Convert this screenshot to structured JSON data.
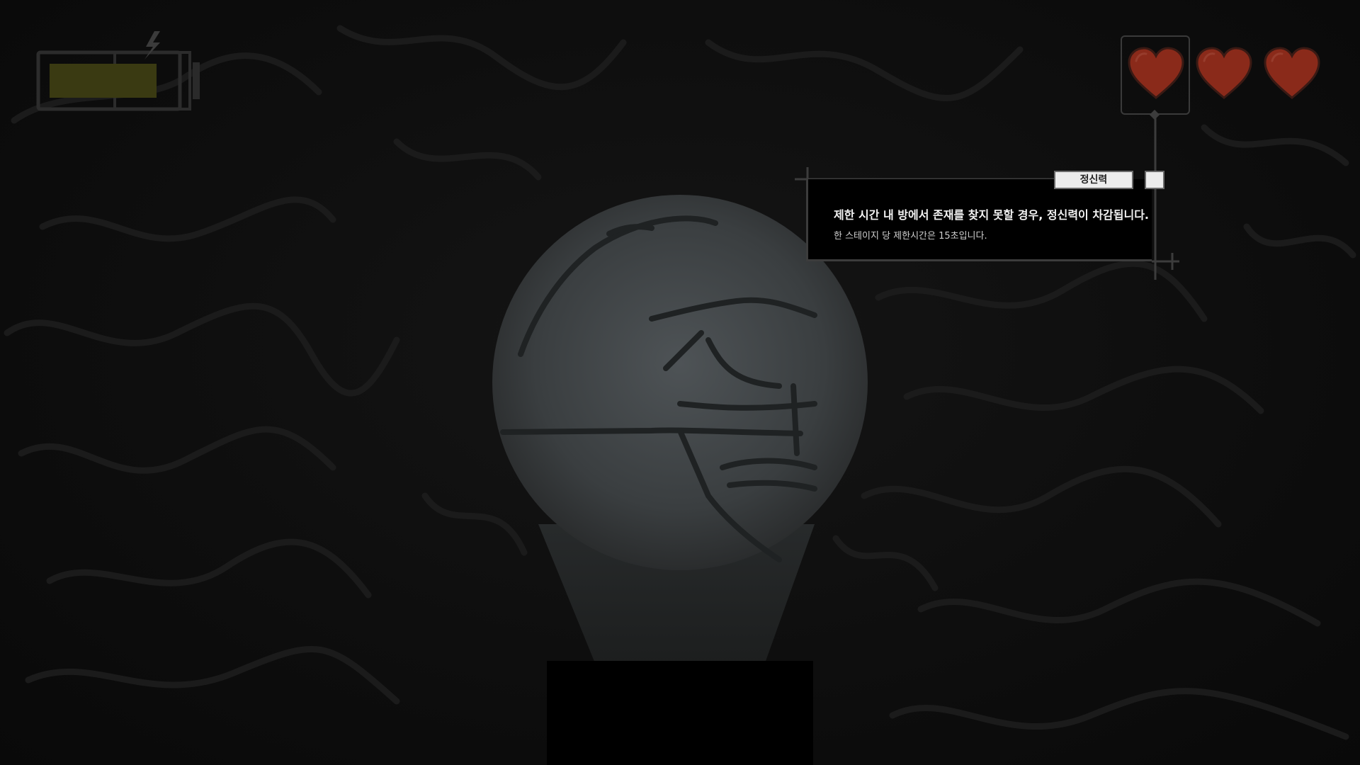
{
  "hud": {
    "battery": {
      "level": 0.9,
      "charging_icon": "lightning-bolt-icon",
      "fill_color": "#3a3a12"
    },
    "sanity_hearts": {
      "max": 3,
      "icon": "heart-icon",
      "color": "#8a2a1a"
    }
  },
  "tooltip": {
    "tab_label": "정신력",
    "title": "제한 시간 내 방에서 존재를 찾지 못할 경우, 정신력이 차감됩니다.",
    "description": "한 스테이지 당 제한시간은 15초입니다."
  },
  "colors": {
    "background": "#0c0c0c",
    "line_art": "#1c1c1c",
    "spotlight": "#4a4f52",
    "tooltip_bg": "#000000",
    "tab_bg": "#ececec"
  }
}
